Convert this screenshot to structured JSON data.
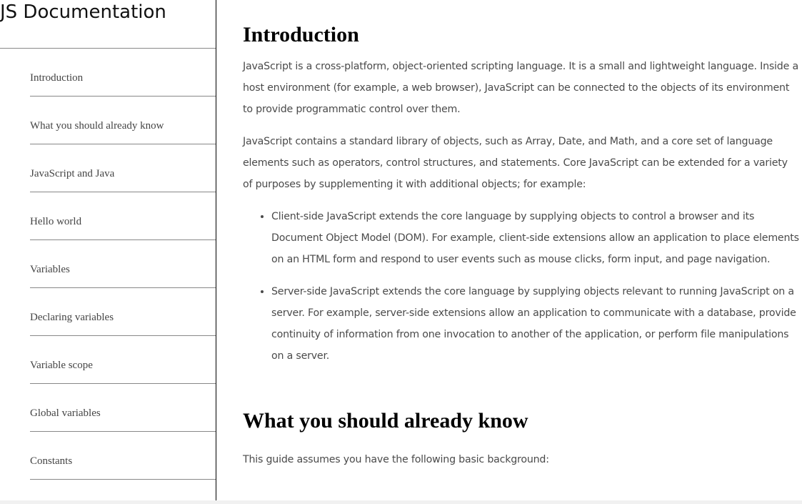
{
  "sidebar": {
    "title": "JS Documentation",
    "items": [
      {
        "label": "Introduction"
      },
      {
        "label": "What you should already know"
      },
      {
        "label": "JavaScript and Java"
      },
      {
        "label": "Hello world"
      },
      {
        "label": "Variables"
      },
      {
        "label": "Declaring variables"
      },
      {
        "label": "Variable scope"
      },
      {
        "label": "Global variables"
      },
      {
        "label": "Constants"
      }
    ]
  },
  "main": {
    "sections": [
      {
        "heading": "Introduction",
        "paragraphs": [
          "JavaScript is a cross-platform, object-oriented scripting language. It is a small and lightweight language. Inside a host environment (for example, a web browser), JavaScript can be connected to the objects of its environment to provide programmatic control over them.",
          "JavaScript contains a standard library of objects, such as Array, Date, and Math, and a core set of language elements such as operators, control structures, and statements. Core JavaScript can be extended for a variety of purposes by supplementing it with additional objects; for example:"
        ],
        "bullets": [
          "Client-side JavaScript extends the core language by supplying objects to control a browser and its Document Object Model (DOM). For example, client-side extensions allow an application to place elements on an HTML form and respond to user events such as mouse clicks, form input, and page navigation.",
          "Server-side JavaScript extends the core language by supplying objects relevant to running JavaScript on a server. For example, server-side extensions allow an application to communicate with a database, provide continuity of information from one invocation to another of the application, or perform file manipulations on a server."
        ]
      },
      {
        "heading": "What you should already know",
        "paragraphs": [
          "This guide assumes you have the following basic background:"
        ]
      }
    ]
  }
}
